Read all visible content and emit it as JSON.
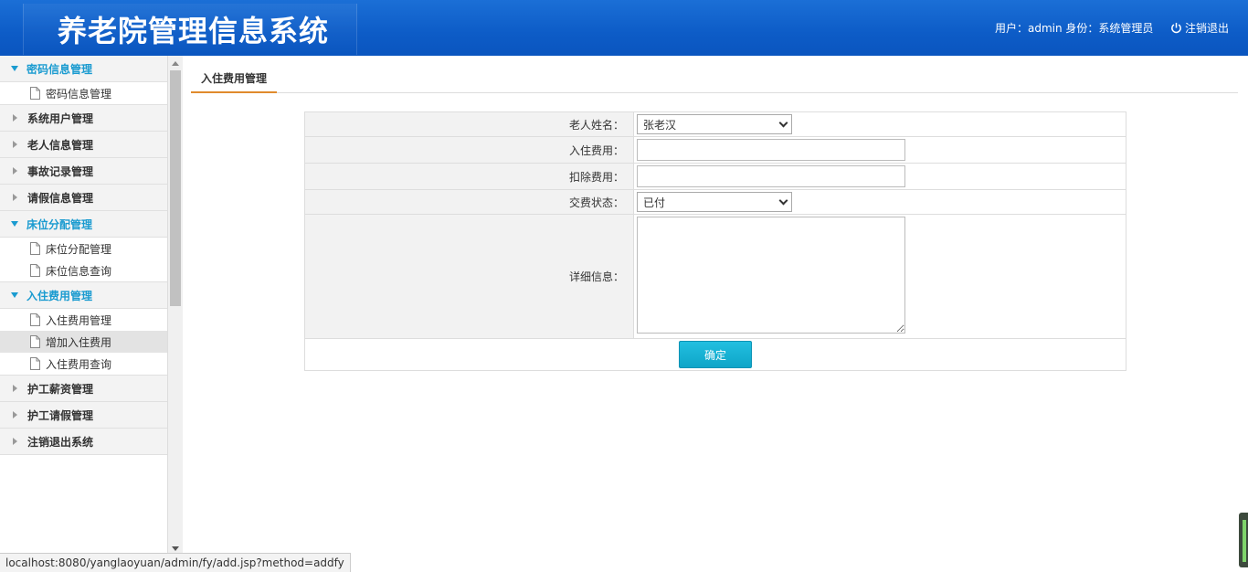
{
  "header": {
    "title": "养老院管理信息系统",
    "user_info": "用户：admin 身份：系统管理员",
    "logout_label": "注销退出"
  },
  "sidebar": {
    "groups": [
      {
        "label": "密码信息管理",
        "open": true,
        "items": [
          {
            "label": "密码信息管理"
          }
        ]
      },
      {
        "label": "系统用户管理",
        "open": false
      },
      {
        "label": "老人信息管理",
        "open": false
      },
      {
        "label": "事故记录管理",
        "open": false
      },
      {
        "label": "请假信息管理",
        "open": false
      },
      {
        "label": "床位分配管理",
        "open": true,
        "items": [
          {
            "label": "床位分配管理"
          },
          {
            "label": "床位信息查询"
          }
        ]
      },
      {
        "label": "入住费用管理",
        "open": true,
        "items": [
          {
            "label": "入住费用管理"
          },
          {
            "label": "增加入住费用",
            "active": true
          },
          {
            "label": "入住费用查询"
          }
        ]
      },
      {
        "label": "护工薪资管理",
        "open": false
      },
      {
        "label": "护工请假管理",
        "open": false
      },
      {
        "label": "注销退出系统",
        "open": false
      }
    ]
  },
  "main": {
    "tab_label": "入住费用管理",
    "form": {
      "elder_name_label": "老人姓名：",
      "elder_name_value": "张老汉",
      "fee_label": "入住费用：",
      "fee_value": "",
      "deduct_label": "扣除费用：",
      "deduct_value": "",
      "status_label": "交费状态：",
      "status_value": "已付",
      "detail_label": "详细信息：",
      "detail_value": "",
      "submit_label": "确定"
    }
  },
  "statusbar": {
    "url": "localhost:8080/yanglaoyuan/admin/fy/add.jsp?method=addfy"
  },
  "colors": {
    "header_blue": "#0d5cc7",
    "accent_cyan": "#1a9bd0",
    "button_cyan": "#0ea5c8",
    "tab_underline": "#e08a2d"
  }
}
